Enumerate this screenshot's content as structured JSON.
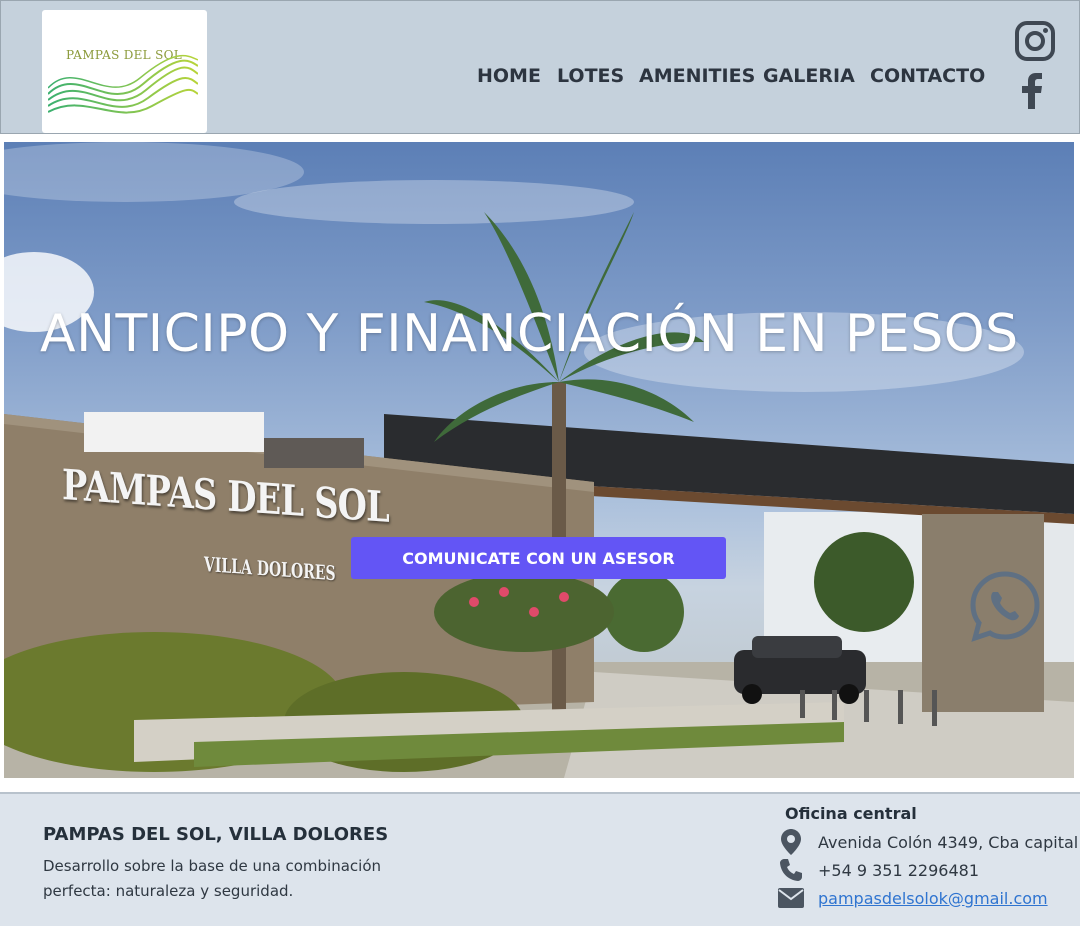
{
  "header": {
    "logo_text": "PAMPAS DEL SOL",
    "nav": [
      {
        "label": "HOME"
      },
      {
        "label": "LOTES"
      },
      {
        "label": "AMENITIES"
      },
      {
        "label": "GALERIA"
      },
      {
        "label": "CONTACTO"
      }
    ],
    "social": [
      "instagram-icon",
      "facebook-icon"
    ]
  },
  "hero": {
    "title": "ANTICIPO Y FINANCIACIÓN EN PESOS",
    "sign_text": "PAMPAS DEL SOL",
    "sign_subtext": "VILLA DOLORES",
    "cta_label": "COMUNICATE CON UN ASESOR",
    "cta_color": "#6355f5"
  },
  "footer": {
    "title": "PAMPAS DEL SOL, VILLA DOLORES",
    "description": "Desarrollo sobre la base de una combinación perfecta: naturaleza y seguridad.",
    "office_heading": "Oficina central",
    "address": "Avenida Colón 4349, Cba capital",
    "phone": "+54 9 351 2296481",
    "email": "pampasdelsolok@gmail.com"
  },
  "colors": {
    "header_bg": "#c5d1dc",
    "footer_bg": "#dde4ec",
    "icon_gray": "#4b5561",
    "link_blue": "#2f74d0"
  }
}
